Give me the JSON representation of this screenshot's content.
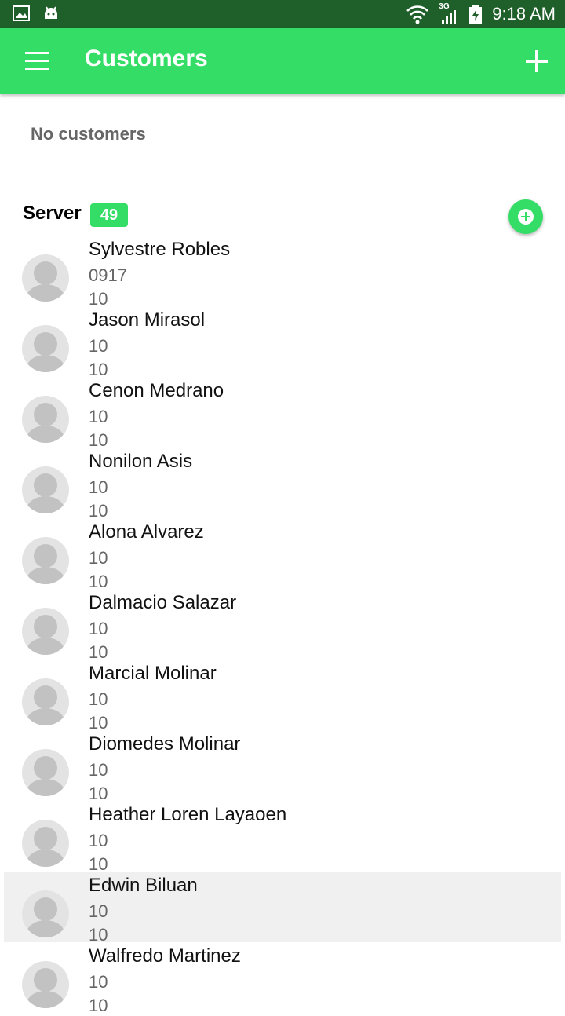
{
  "status_bar": {
    "time": "9:18 AM",
    "network": "3G"
  },
  "app_bar": {
    "title": "Customers"
  },
  "empty_message": "No customers",
  "server": {
    "label": "Server",
    "count": "49"
  },
  "customers": [
    {
      "name": "Sylvestre Robles",
      "line1": "0917",
      "line2": "10"
    },
    {
      "name": "Jason Mirasol",
      "line1": "10",
      "line2": "10"
    },
    {
      "name": "Cenon Medrano",
      "line1": "10",
      "line2": "10"
    },
    {
      "name": "Nonilon Asis",
      "line1": "10",
      "line2": "10"
    },
    {
      "name": "Alona Alvarez",
      "line1": "10",
      "line2": "10"
    },
    {
      "name": "Dalmacio Salazar",
      "line1": "10",
      "line2": "10"
    },
    {
      "name": "Marcial Molinar",
      "line1": "10",
      "line2": "10"
    },
    {
      "name": "Diomedes Molinar",
      "line1": "10",
      "line2": "10"
    },
    {
      "name": "Heather Loren Layaoen",
      "line1": "10",
      "line2": "10"
    },
    {
      "name": "Edwin Biluan",
      "line1": "10",
      "line2": "10",
      "selected": true
    },
    {
      "name": "Walfredo Martinez",
      "line1": "10",
      "line2": "10"
    }
  ],
  "colors": {
    "accent": "#33dd66",
    "status_bar": "#1f5f2a",
    "selected_row": "#f0f0f0"
  }
}
